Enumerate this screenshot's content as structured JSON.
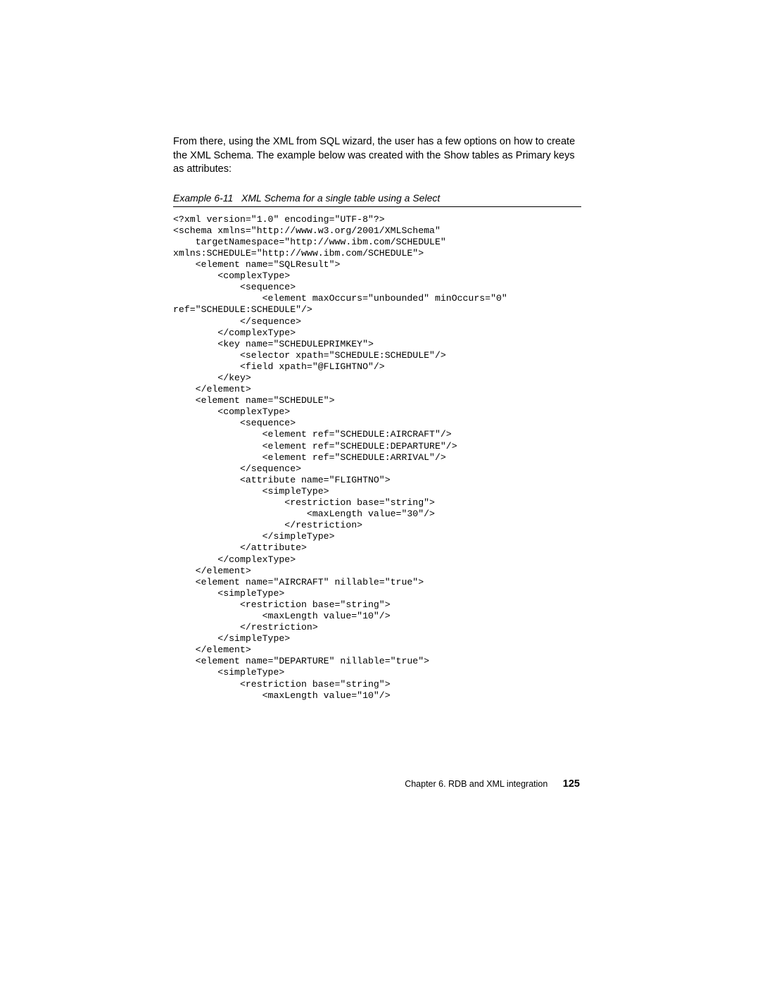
{
  "intro": "From there, using the XML from SQL wizard, the user has a few options on how to create the XML Schema. The example below was created with the Show tables as Primary keys as attributes:",
  "caption_label": "Example 6-11",
  "caption_text": "XML Schema for a single table using a Select",
  "code": "<?xml version=\"1.0\" encoding=\"UTF-8\"?>\n<schema xmlns=\"http://www.w3.org/2001/XMLSchema\"\n    targetNamespace=\"http://www.ibm.com/SCHEDULE\"\nxmlns:SCHEDULE=\"http://www.ibm.com/SCHEDULE\">\n    <element name=\"SQLResult\">\n        <complexType>\n            <sequence>\n                <element maxOccurs=\"unbounded\" minOccurs=\"0\"\nref=\"SCHEDULE:SCHEDULE\"/>\n            </sequence>\n        </complexType>\n        <key name=\"SCHEDULEPRIMKEY\">\n            <selector xpath=\"SCHEDULE:SCHEDULE\"/>\n            <field xpath=\"@FLIGHTNO\"/>\n        </key>\n    </element>\n    <element name=\"SCHEDULE\">\n        <complexType>\n            <sequence>\n                <element ref=\"SCHEDULE:AIRCRAFT\"/>\n                <element ref=\"SCHEDULE:DEPARTURE\"/>\n                <element ref=\"SCHEDULE:ARRIVAL\"/>\n            </sequence>\n            <attribute name=\"FLIGHTNO\">\n                <simpleType>\n                    <restriction base=\"string\">\n                        <maxLength value=\"30\"/>\n                    </restriction>\n                </simpleType>\n            </attribute>\n        </complexType>\n    </element>\n    <element name=\"AIRCRAFT\" nillable=\"true\">\n        <simpleType>\n            <restriction base=\"string\">\n                <maxLength value=\"10\"/>\n            </restriction>\n        </simpleType>\n    </element>\n    <element name=\"DEPARTURE\" nillable=\"true\">\n        <simpleType>\n            <restriction base=\"string\">\n                <maxLength value=\"10\"/>",
  "footer_chapter": "Chapter 6. RDB and XML integration",
  "footer_page": "125"
}
